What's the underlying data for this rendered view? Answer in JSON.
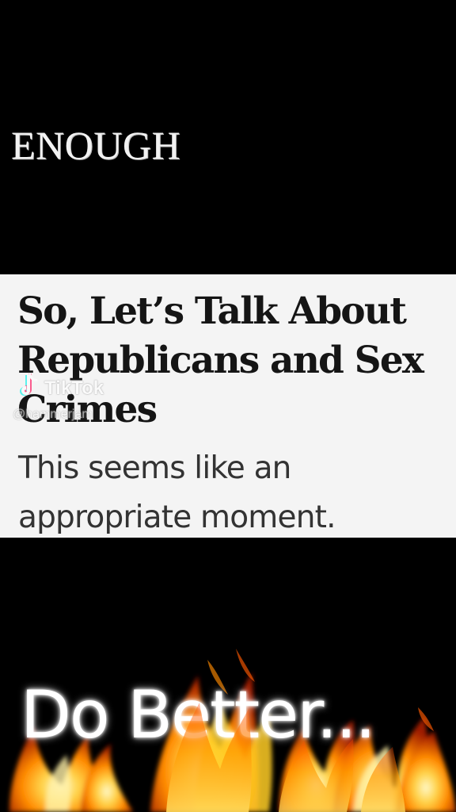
{
  "video": {
    "top_text": "ENOUGH",
    "bottom_text": "Do Better..."
  },
  "article": {
    "headline": "So, Let’s Talk About Republicans and Sex Crimes",
    "subhead": "This seems like an appropriate moment."
  },
  "watermark": {
    "brand": "TikTok",
    "handle": "@hammerjam",
    "icon": "tiktok-icon"
  },
  "colors": {
    "background": "#000000",
    "article_background": "#f4f4f4",
    "headline": "#151515",
    "subhead": "#333333",
    "fire_core": "#fff3b0",
    "fire_mid": "#ffb000",
    "fire_outer": "#ff4a00"
  },
  "decorative": {
    "fire_effect": "fire-flames"
  }
}
